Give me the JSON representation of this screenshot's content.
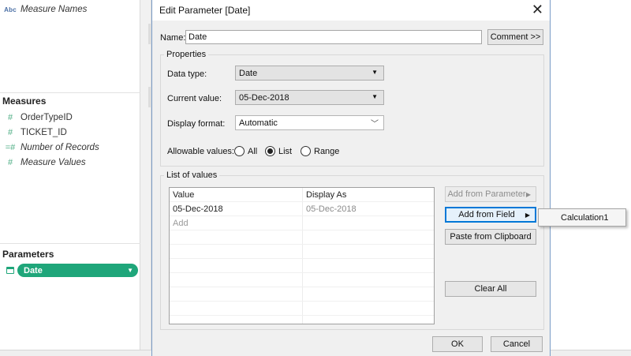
{
  "left_pane": {
    "dimension_fields": [
      {
        "icon": "abc-icon",
        "icon_text": "Abc",
        "label": "Measure Names"
      }
    ],
    "measures_title": "Measures",
    "measures": [
      {
        "icon": "hash-icon",
        "icon_text": "#",
        "label": "OrderTypeID",
        "italic": false
      },
      {
        "icon": "hash-icon",
        "icon_text": "#",
        "label": "TICKET_ID",
        "italic": false
      },
      {
        "icon": "calc-hash-icon",
        "icon_text": "=#",
        "label": "Number of Records",
        "italic": true
      },
      {
        "icon": "hash-icon",
        "icon_text": "#",
        "label": "Measure Values",
        "italic": true
      }
    ],
    "parameters_title": "Parameters",
    "parameter_pill": "Date"
  },
  "dialog": {
    "title": "Edit Parameter [Date]",
    "name_label": "Name:",
    "name_value": "Date",
    "comment_button": "Comment >>",
    "properties_label": "Properties",
    "data_type_label": "Data type:",
    "data_type_value": "Date",
    "current_value_label": "Current value:",
    "current_value": "05-Dec-2018",
    "display_format_label": "Display format:",
    "display_format_value": "Automatic",
    "allowable_label": "Allowable values:",
    "allowable_options": [
      "All",
      "List",
      "Range"
    ],
    "allowable_selected": "List",
    "list_label": "List of values",
    "list_columns": [
      "Value",
      "Display As"
    ],
    "list_rows": [
      {
        "value": "05-Dec-2018",
        "display": "05-Dec-2018"
      },
      {
        "value": "Add",
        "display": ""
      }
    ],
    "add_from_parameter": "Add from Parameter",
    "add_from_field": "Add from Field",
    "paste_from_clipboard": "Paste from Clipboard",
    "clear_all": "Clear All",
    "ok": "OK",
    "cancel": "Cancel"
  },
  "popup_menu": {
    "item": "Calculation1"
  },
  "colors": {
    "parameter_pill": "#1fa67a",
    "accent_border": "#0078d7"
  }
}
